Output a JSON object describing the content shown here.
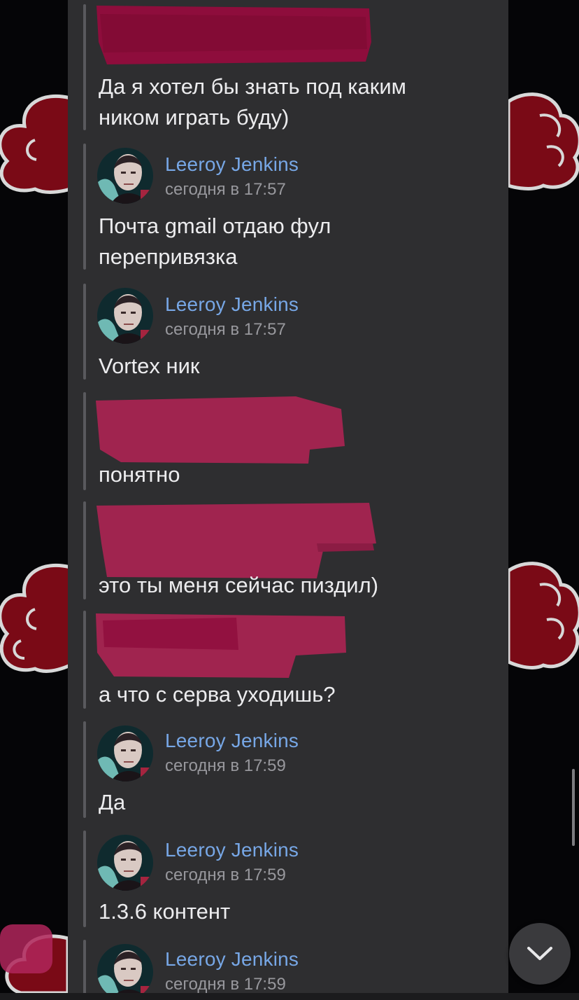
{
  "colors": {
    "panel": "#2e2e30",
    "author": "#77a7e6",
    "timestamp": "#98989d",
    "text": "#ececee",
    "redaction": "#a0244f",
    "cloud": "#7a0a16"
  },
  "messages": [
    {
      "kind": "continuation",
      "redacted": true,
      "lines": [
        "Да я хотел бы знать под каким",
        "ником играть буду)"
      ]
    },
    {
      "kind": "full",
      "author": "Leeroy Jenkins",
      "time": "сегодня в 17:57",
      "lines": [
        "Почта gmail отдаю фул",
        "перепривязка"
      ]
    },
    {
      "kind": "full",
      "author": "Leeroy Jenkins",
      "time": "сегодня в 17:57",
      "lines": [
        "Vortex ник"
      ]
    },
    {
      "kind": "redacted",
      "lines": [
        "понятно"
      ]
    },
    {
      "kind": "redacted",
      "lines": [
        "это ты меня сейчас пиздил)"
      ]
    },
    {
      "kind": "redacted",
      "lines": [
        "а что с серва уходишь?"
      ]
    },
    {
      "kind": "full",
      "author": "Leeroy Jenkins",
      "time": "сегодня в 17:59",
      "lines": [
        "Да"
      ]
    },
    {
      "kind": "full",
      "author": "Leeroy Jenkins",
      "time": "сегодня в 17:59",
      "lines": [
        "1.3.6 контент"
      ]
    },
    {
      "kind": "full",
      "author": "Leeroy Jenkins",
      "time": "сегодня в 17:59",
      "lines": []
    }
  ],
  "scroll_down_icon": "chevron-down-icon",
  "avatar_icon": "user-avatar"
}
